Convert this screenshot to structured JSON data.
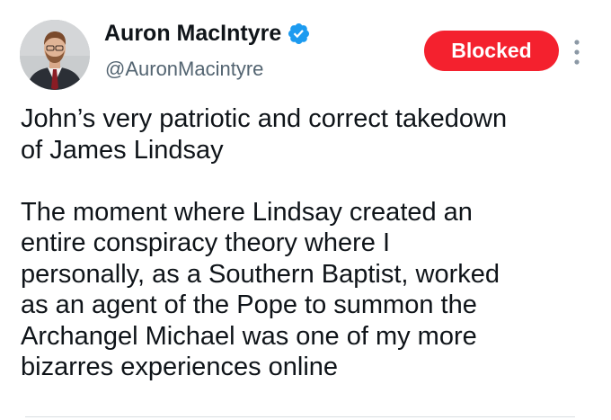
{
  "author": {
    "display_name": "Auron MacIntyre",
    "handle": "@AuronMacintyre",
    "avatar_icon": "profile-photo",
    "verified_icon": "verified-badge-icon",
    "verified_color": "#1d9bf0"
  },
  "actions": {
    "blocked_label": "Blocked",
    "blocked_color": "#f4212e",
    "more_icon": "more-vertical-icon"
  },
  "tweet": {
    "paragraph_1": "John’s very patriotic and correct takedown\nof James Lindsay",
    "paragraph_2": "The moment where Lindsay created an\nentire conspiracy theory where I\npersonally, as a Southern Baptist, worked\nas an agent of the Pope to summon the\nArchangel Michael was one of my more\nbizarres experiences online"
  }
}
